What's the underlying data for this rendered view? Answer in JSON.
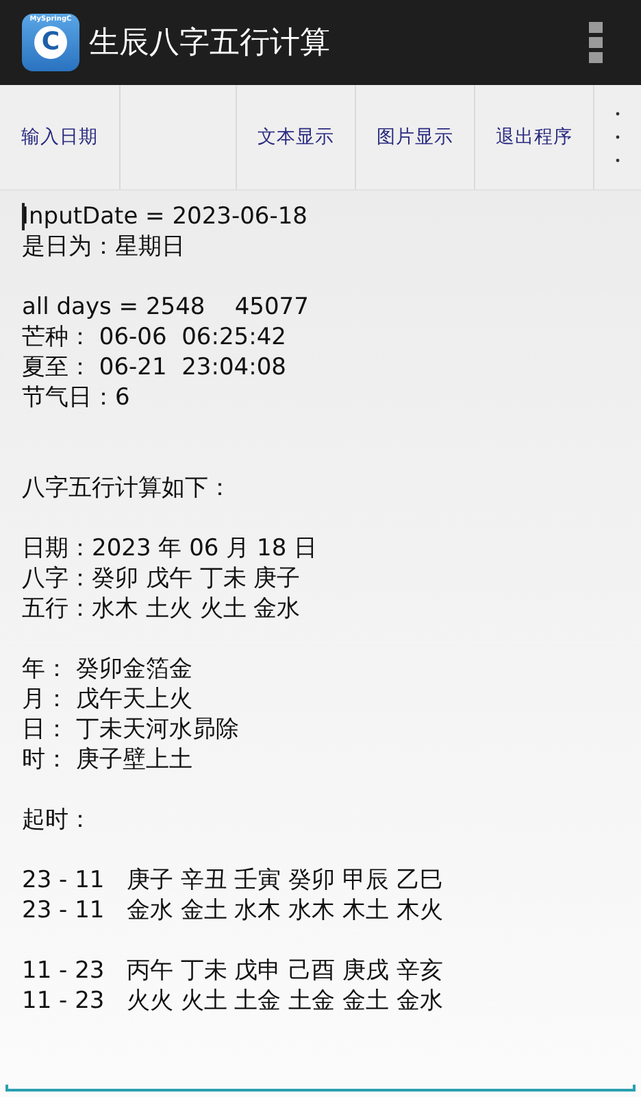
{
  "action_bar": {
    "logo": {
      "caption": "MySpringC",
      "letter": "C"
    },
    "title": "生辰八字五行计算"
  },
  "toolbar": [
    {
      "kind": "text",
      "label": "输入日期"
    },
    {
      "kind": "blank"
    },
    {
      "kind": "text",
      "label": "文本显示"
    },
    {
      "kind": "text",
      "label": "图片显示"
    },
    {
      "kind": "text",
      "label": "退出程序"
    },
    {
      "kind": "overflow"
    }
  ],
  "output": {
    "cursor": true,
    "paragraphs": [
      [
        "InputDate = 2023-06-18",
        "是日为：星期日"
      ],
      [
        "all days = 2548    45077",
        "芒种： 06-06  06:25:42",
        "夏至： 06-21  23:04:08",
        "节气日：6"
      ],
      [
        "八字五行计算如下："
      ],
      [
        "日期：2023 年 06 月 18 日",
        "八字：癸卯 戊午 丁未 庚子",
        "五行：水木 土火 火土 金水"
      ],
      [
        "年： 癸卯金箔金",
        "月： 戊午天上火",
        "日： 丁未天河水昴除",
        "时： 庚子壁上土"
      ],
      [
        "起时："
      ],
      [
        "23 - 11   庚子 辛丑 壬寅 癸卯 甲辰 乙巳",
        "23 - 11   金水 金土 水木 水木 木土 木火"
      ],
      [
        "11 - 23   丙午 丁未 戊申 己酉 庚戌 辛亥",
        "11 - 23   火火 火土 土金 土金 金土 金水"
      ]
    ]
  }
}
